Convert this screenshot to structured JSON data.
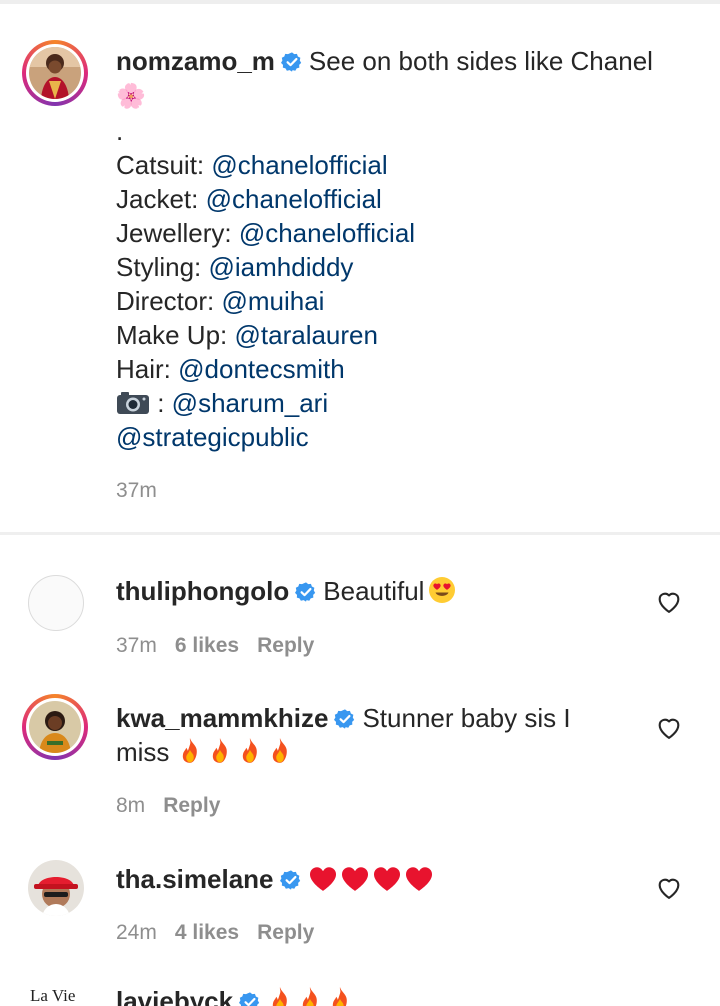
{
  "caption": {
    "username": "nomzamo_m",
    "text_first": "See on both sides like Chanel",
    "flower": "🌸",
    "dot": ".",
    "credits": [
      {
        "label": "Catsuit: ",
        "mention": "@chanelofficial"
      },
      {
        "label": "Jacket: ",
        "mention": "@chanelofficial"
      },
      {
        "label": "Jewellery: ",
        "mention": "@chanelofficial"
      },
      {
        "label": "Styling: ",
        "mention": "@iamhdiddy"
      },
      {
        "label": "Director: ",
        "mention": "@muihai"
      },
      {
        "label": "Make Up: ",
        "mention": "@taralauren"
      },
      {
        "label": "Hair: ",
        "mention": "@dontecsmith"
      }
    ],
    "camera_line": {
      "separator": " : ",
      "mention": "@sharum_ari"
    },
    "last_mention": "@strategicpublic",
    "time": "37m"
  },
  "comments": [
    {
      "username": "thuliphongolo",
      "text": "Beautiful",
      "time": "37m",
      "likes": "6 likes",
      "reply": "Reply"
    },
    {
      "username": "kwa_mammkhize",
      "text_line1": "Stunner baby sis I",
      "text_line2": "miss",
      "time": "8m",
      "reply": "Reply"
    },
    {
      "username": "tha.simelane",
      "time": "24m",
      "likes": "4 likes",
      "reply": "Reply"
    },
    {
      "username": "laviebyck"
    }
  ],
  "icons": {
    "verified": "verified-badge-icon",
    "like": "heart-outline-icon",
    "camera": "camera-emoji"
  },
  "colors": {
    "mention": "#00376b",
    "verified": "#3897f0",
    "meta": "#8e8e8e"
  }
}
